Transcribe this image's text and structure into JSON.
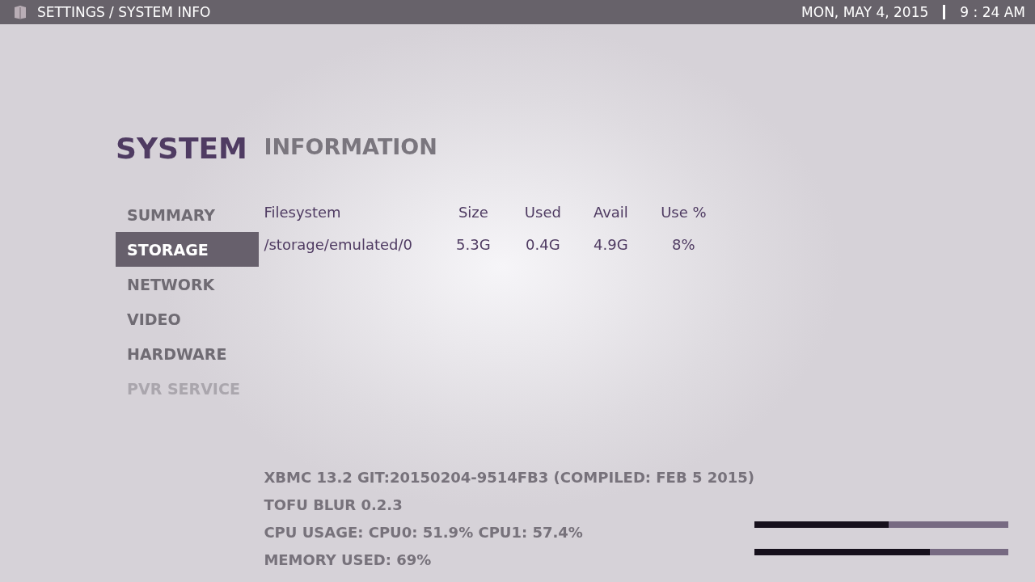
{
  "header": {
    "breadcrumb": "SETTINGS / SYSTEM INFO",
    "date": "MON, MAY 4, 2015",
    "time": "9 : 24 AM"
  },
  "sidebar": {
    "title": "SYSTEM",
    "items": [
      {
        "label": "SUMMARY",
        "selected": false,
        "disabled": false
      },
      {
        "label": "STORAGE",
        "selected": true,
        "disabled": false
      },
      {
        "label": "NETWORK",
        "selected": false,
        "disabled": false
      },
      {
        "label": "VIDEO",
        "selected": false,
        "disabled": false
      },
      {
        "label": "HARDWARE",
        "selected": false,
        "disabled": false
      },
      {
        "label": "PVR SERVICE",
        "selected": false,
        "disabled": true
      }
    ]
  },
  "content": {
    "title": "INFORMATION",
    "table": {
      "columns": [
        "Filesystem",
        "Size",
        "Used",
        "Avail",
        "Use %"
      ],
      "rows": [
        [
          "/storage/emulated/0",
          "5.3G",
          "0.4G",
          "4.9G",
          "8%"
        ]
      ]
    }
  },
  "footer": {
    "lines": [
      "XBMC 13.2 GIT:20150204-9514FB3 (COMPILED: FEB  5 2015)",
      "TOFU BLUR  0.2.3",
      "CPU USAGE: CPU0: 51.9% CPU1: 57.4%",
      "MEMORY USED: 69%"
    ],
    "meters": [
      {
        "level": 0.53
      },
      {
        "level": 0.69
      }
    ]
  }
}
